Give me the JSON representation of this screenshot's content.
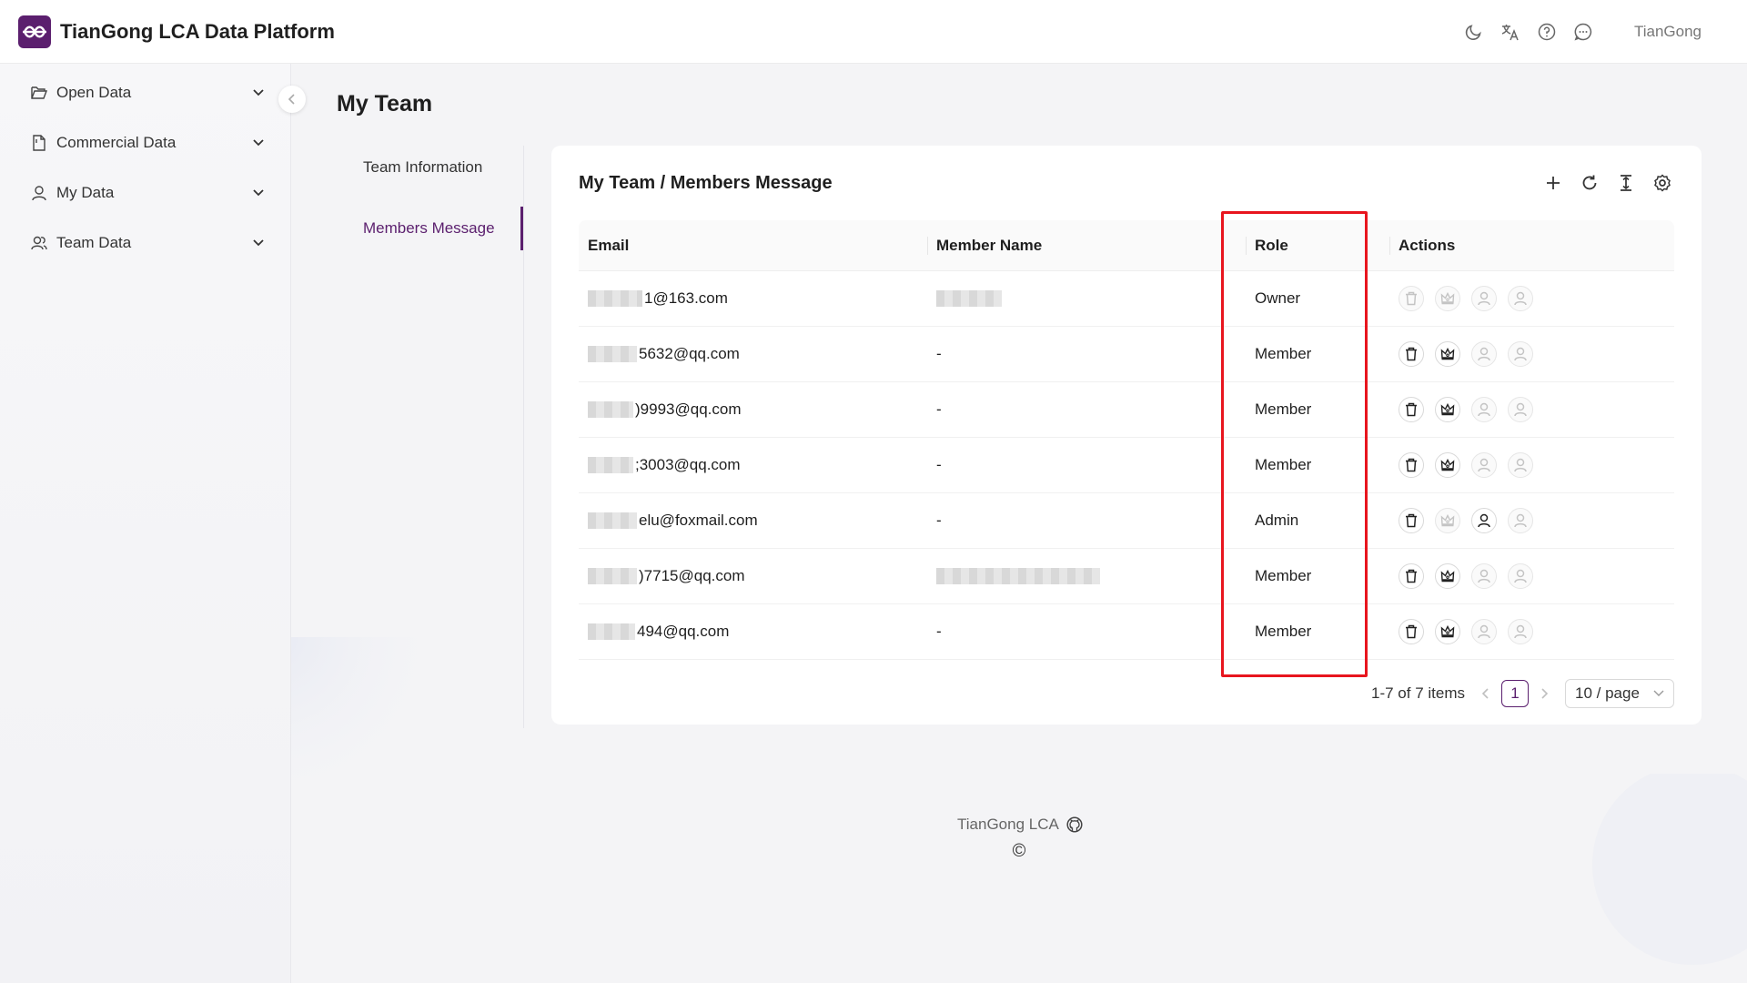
{
  "app": {
    "title": "TianGong LCA Data Platform",
    "user": "TianGong"
  },
  "header_icons": [
    "moon-icon",
    "translate-icon",
    "help-icon",
    "message-icon"
  ],
  "sidebar": {
    "items": [
      {
        "label": "Open Data",
        "icon": "folder-open-icon"
      },
      {
        "label": "Commercial Data",
        "icon": "file-icon"
      },
      {
        "label": "My Data",
        "icon": "user-icon"
      },
      {
        "label": "Team Data",
        "icon": "team-icon"
      }
    ]
  },
  "page": {
    "title": "My Team"
  },
  "tabs": [
    {
      "label": "Team Information",
      "active": false
    },
    {
      "label": "Members Message",
      "active": true
    }
  ],
  "card": {
    "title": "My Team / Members Message",
    "toolbar": [
      "plus-icon",
      "reload-icon",
      "column-height-icon",
      "settings-icon"
    ]
  },
  "table": {
    "columns": [
      "Email",
      "Member Name",
      "Role",
      "Actions"
    ],
    "rows": [
      {
        "email": "1@163.com",
        "name": "",
        "role": "Owner",
        "actions": [
          false,
          false,
          false,
          false
        ]
      },
      {
        "email": "5632@qq.com",
        "name": "-",
        "role": "Member",
        "actions": [
          true,
          true,
          false,
          false
        ]
      },
      {
        "email": ")9993@qq.com",
        "name": "-",
        "role": "Member",
        "actions": [
          true,
          true,
          false,
          false
        ]
      },
      {
        "email": ";3003@qq.com",
        "name": "-",
        "role": "Member",
        "actions": [
          true,
          true,
          false,
          false
        ]
      },
      {
        "email": "elu@foxmail.com",
        "name": "-",
        "role": "Admin",
        "actions": [
          true,
          false,
          true,
          false
        ]
      },
      {
        "email": ")7715@qq.com",
        "name": "",
        "role": "Member",
        "actions": [
          true,
          true,
          false,
          false
        ]
      },
      {
        "email": "494@qq.com",
        "name": "-",
        "role": "Member",
        "actions": [
          true,
          true,
          false,
          false
        ]
      }
    ]
  },
  "pagination": {
    "total": "1-7 of 7 items",
    "current": "1",
    "page_size": "10 / page"
  },
  "footer": {
    "text": "TianGong LCA",
    "copyright": "©"
  },
  "colors": {
    "brand": "#5b1f6e",
    "highlight": "#e8151e"
  }
}
